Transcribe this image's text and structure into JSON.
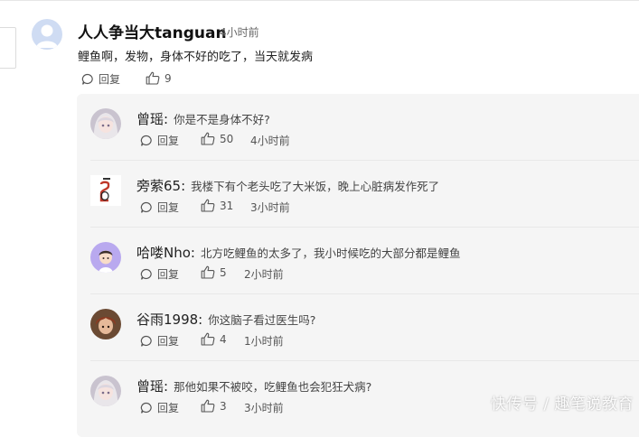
{
  "main_comment": {
    "author": "人人争当大tanguan",
    "time": "4小时前",
    "text": "鲤鱼啊，发物，身体不好的吃了，当天就发病",
    "reply_label": "回复",
    "likes": "9"
  },
  "replies": [
    {
      "author": "曾瑶:",
      "text": "你是不是身体不好?",
      "reply_label": "回复",
      "likes": "50",
      "time": "4小时前",
      "avatar_icon": "anime-girl-avatar"
    },
    {
      "author": "旁萦65:",
      "text": "我楼下有个老头吃了大米饭，晚上心脏病发作死了",
      "reply_label": "回复",
      "likes": "31",
      "time": "3小时前",
      "avatar_icon": "book-cover-avatar"
    },
    {
      "author": "哈喽Nho:",
      "text": "北方吃鲤鱼的太多了，我小时候吃的大部分都是鲤鱼",
      "reply_label": "回复",
      "likes": "5",
      "time": "2小时前",
      "avatar_icon": "cartoon-boy-avatar"
    },
    {
      "author": "谷雨1998:",
      "text": "你这脑子看过医生吗?",
      "reply_label": "回复",
      "likes": "4",
      "time": "1小时前",
      "avatar_icon": "anime-character-avatar"
    },
    {
      "author": "曾瑶:",
      "text": "那他如果不被咬，吃鲤鱼也会犯狂犬病?",
      "reply_label": "回复",
      "likes": "3",
      "time": "3小时前",
      "avatar_icon": "anime-girl-avatar"
    }
  ],
  "watermark": "快传号 / 趣笔说教育",
  "colors": {
    "panel_bg": "#f5f5f5",
    "text_main": "#222222",
    "text_muted": "#555555",
    "avatar_default": "#cfdcf3"
  }
}
